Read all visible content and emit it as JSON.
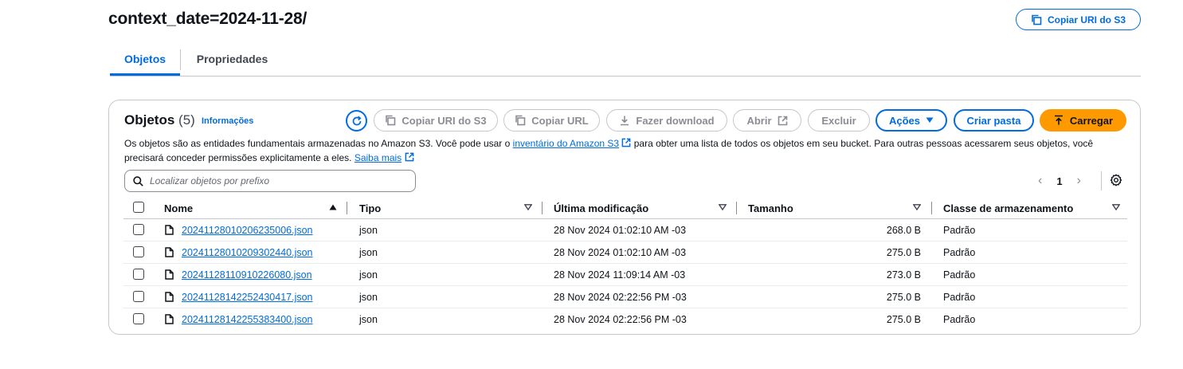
{
  "header": {
    "title": "context_date=2024-11-28/",
    "copy_uri_label": "Copiar URI do S3"
  },
  "tabs": [
    {
      "label": "Objetos",
      "active": true
    },
    {
      "label": "Propriedades",
      "active": false
    }
  ],
  "objects_panel": {
    "title": "Objetos",
    "count": "(5)",
    "info_link": "Informações",
    "toolbar": {
      "copy_uri": "Copiar URI do S3",
      "copy_url": "Copiar URL",
      "download": "Fazer download",
      "open": "Abrir",
      "delete": "Excluir",
      "actions": "Ações",
      "create_folder": "Criar pasta",
      "upload": "Carregar"
    },
    "description": {
      "part1": "Os objetos são as entidades fundamentais armazenadas no Amazon S3. Você pode usar o ",
      "inventory_link": "inventário do Amazon S3",
      "part2": " para obter uma lista de todos os objetos em seu bucket. Para outras pessoas acessarem seus objetos, você precisará conceder permissões explicitamente a eles. ",
      "learn_more_link": "Saiba mais"
    },
    "search": {
      "placeholder": "Localizar objetos por prefixo",
      "value": ""
    },
    "pagination": {
      "current_page": "1"
    },
    "columns": [
      "Nome",
      "Tipo",
      "Última modificação",
      "Tamanho",
      "Classe de armazenamento"
    ],
    "rows": [
      {
        "name": "20241128010206235006.json",
        "type": "json",
        "modified": "28 Nov 2024 01:02:10 AM -03",
        "size": "268.0 B",
        "storage_class": "Padrão"
      },
      {
        "name": "20241128010209302440.json",
        "type": "json",
        "modified": "28 Nov 2024 01:02:10 AM -03",
        "size": "275.0 B",
        "storage_class": "Padrão"
      },
      {
        "name": "20241128110910226080.json",
        "type": "json",
        "modified": "28 Nov 2024 11:09:14 AM -03",
        "size": "273.0 B",
        "storage_class": "Padrão"
      },
      {
        "name": "20241128142252430417.json",
        "type": "json",
        "modified": "28 Nov 2024 02:22:56 PM -03",
        "size": "275.0 B",
        "storage_class": "Padrão"
      },
      {
        "name": "20241128142255383400.json",
        "type": "json",
        "modified": "28 Nov 2024 02:22:56 PM -03",
        "size": "275.0 B",
        "storage_class": "Padrão"
      }
    ]
  },
  "colors": {
    "accent": "#006ce0",
    "primary_button": "#ff9900",
    "disabled": "#8c8c94",
    "border": "#c6c6cd"
  },
  "icons": [
    "copy-icon",
    "refresh-icon",
    "download-icon",
    "external-link-icon",
    "caret-down-icon",
    "upload-icon",
    "search-icon",
    "chevron-left-icon",
    "chevron-right-icon",
    "settings-icon",
    "file-icon",
    "sort-ascending-icon",
    "sort-descending-icon"
  ]
}
